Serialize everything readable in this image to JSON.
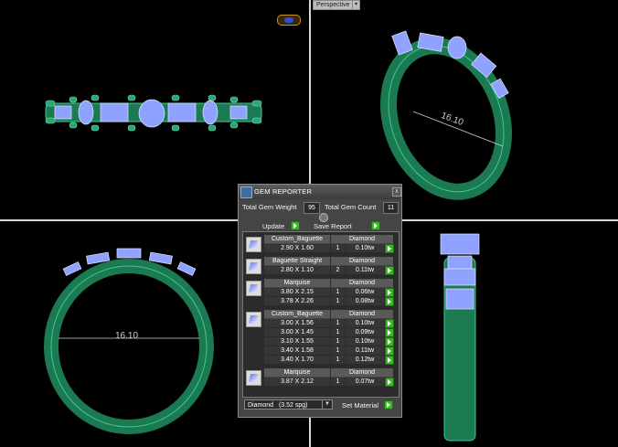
{
  "viewport": {
    "label": "Perspective",
    "dropdown_glyph": "▾"
  },
  "dimensions": {
    "front": "16.10",
    "perspective": "16.10"
  },
  "panel": {
    "title": "GEM REPORTER",
    "close_glyph": "x",
    "total_weight_label": "Total Gem Weight",
    "total_weight_value": "95",
    "total_count_label": "Total Gem Count",
    "total_count_value": "11",
    "update_label": "Update",
    "save_report_label": "Save Report",
    "groups": [
      {
        "name": "Custom_Baguette",
        "material": "Diamond",
        "rows": [
          {
            "size": "2.90 X 1.60",
            "qty": "1",
            "wt": "0.10tw"
          }
        ]
      },
      {
        "name": "Baguette Straight",
        "material": "Diamond",
        "rows": [
          {
            "size": "2.80 X 1.10",
            "qty": "2",
            "wt": "0.11tw"
          }
        ]
      },
      {
        "name": "Marquise",
        "material": "Diamond",
        "rows": [
          {
            "size": "3.80 X 2.15",
            "qty": "1",
            "wt": "0.06tw"
          },
          {
            "size": "3.78 X 2.26",
            "qty": "1",
            "wt": "0.08tw"
          }
        ]
      },
      {
        "name": "Custom_Baguette",
        "material": "Diamond",
        "rows": [
          {
            "size": "3.00 X 1.56",
            "qty": "1",
            "wt": "0.10tw"
          },
          {
            "size": "3.00 X 1.45",
            "qty": "1",
            "wt": "0.09tw"
          },
          {
            "size": "3.10 X 1.55",
            "qty": "1",
            "wt": "0.10tw"
          },
          {
            "size": "3.40 X 1.58",
            "qty": "1",
            "wt": "0.11tw"
          },
          {
            "size": "3.40 X 1.70",
            "qty": "1",
            "wt": "0.12tw"
          }
        ]
      },
      {
        "name": "Marquise",
        "material": "Diamond",
        "rows": [
          {
            "size": "3.87 X 2.12",
            "qty": "1",
            "wt": "0.07tw"
          }
        ]
      }
    ],
    "material_select": "Diamond",
    "material_select_spg": "(3.52 spg)",
    "set_material_label": "Set Material"
  },
  "colors": {
    "metal": "#1f8a5c",
    "metal_light": "#3fc795",
    "gem": "#8fa2ff",
    "gem_light": "#dfe6ff",
    "accent_green": "#3fb52c"
  }
}
